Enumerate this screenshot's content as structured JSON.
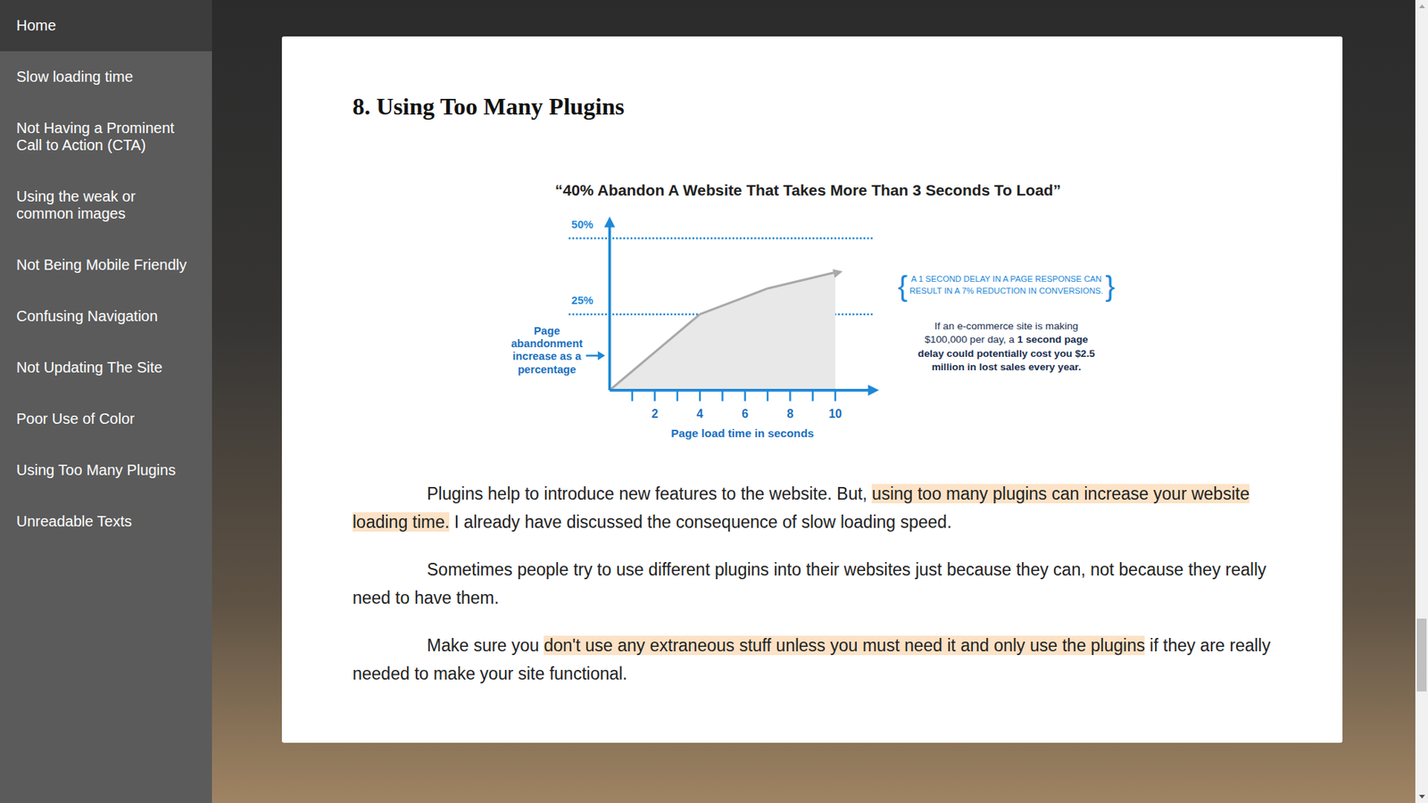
{
  "sidebar": {
    "items": [
      {
        "label": "Home",
        "selected": true
      },
      {
        "label": "Slow loading time",
        "selected": false
      },
      {
        "label": "Not Having a Prominent Call to Action (CTA)",
        "selected": false
      },
      {
        "label": "Using the weak or common images",
        "selected": false
      },
      {
        "label": "Not Being Mobile Friendly",
        "selected": false
      },
      {
        "label": "Confusing Navigation",
        "selected": false
      },
      {
        "label": "Not Updating The Site",
        "selected": false
      },
      {
        "label": "Poor Use of Color",
        "selected": false
      },
      {
        "label": "Using Too Many Plugins",
        "selected": false
      },
      {
        "label": "Unreadable Texts",
        "selected": false
      }
    ]
  },
  "article": {
    "heading": "8. Using Too Many Plugins",
    "chart": {
      "title": "“40% Abandon A Website That Takes More Than 3 Seconds To Load”",
      "y_ticks": [
        {
          "label": "50%",
          "value": 50
        },
        {
          "label": "25%",
          "value": 25
        }
      ],
      "y_axis_label": [
        "Page",
        "abandonment",
        "increase as a",
        "percentage"
      ],
      "x_ticks": [
        {
          "label": "2",
          "value": 2
        },
        {
          "label": "4",
          "value": 4
        },
        {
          "label": "6",
          "value": 6
        },
        {
          "label": "8",
          "value": 8
        },
        {
          "label": "10",
          "value": 10
        }
      ],
      "x_axis_label": "Page load time in seconds",
      "series": [
        {
          "x": [
            0,
            4,
            7,
            10
          ],
          "values": [
            0,
            25,
            33.5,
            38.8
          ]
        }
      ],
      "callout": {
        "open": "{",
        "close": "}",
        "lines": [
          "A 1 SECOND DELAY IN A PAGE RESPONSE CAN",
          "RESULT IN A 7% REDUCTION IN CONVERSIONS."
        ]
      },
      "note": {
        "lines": [
          [
            {
              "text": "If an e-commerce site is making",
              "bold": false
            }
          ],
          [
            {
              "text": "$100,000 per day, a ",
              "bold": false
            },
            {
              "text": "1 second page",
              "bold": true
            }
          ],
          [
            {
              "text": "delay could potentially cost you $2.5",
              "bold": true
            }
          ],
          [
            {
              "text": "million in lost sales every year.",
              "bold": true
            }
          ]
        ]
      }
    },
    "paragraphs": [
      {
        "segments": [
          {
            "text": "Plugins help to introduce new features to the website. But, ",
            "highlighted": false
          },
          {
            "text": "using too many plugins can increase your website loading time.",
            "highlighted": true
          },
          {
            "text": " I already have discussed the consequence of slow loading speed.",
            "highlighted": false
          }
        ]
      },
      {
        "segments": [
          {
            "text": "Sometimes people try to use different plugins into their websites just because they can, not because they really need to have them.",
            "highlighted": false
          }
        ]
      },
      {
        "segments": [
          {
            "text": "Make sure you ",
            "highlighted": false
          },
          {
            "text": "don't use any extraneous stuff unless you must need it and only use the plugins",
            "highlighted": true
          },
          {
            "text": " if they are really needed to make your site functional.",
            "highlighted": false
          }
        ]
      }
    ]
  },
  "scrollbar": {
    "level": 0.86
  }
}
